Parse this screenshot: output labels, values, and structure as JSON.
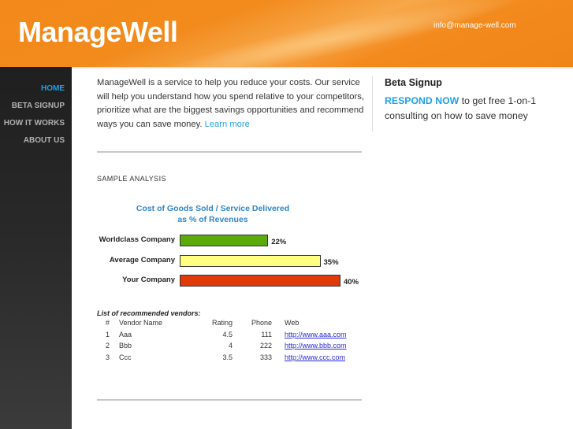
{
  "header": {
    "logo": "ManageWell",
    "email": "info@manage-well.com"
  },
  "sidebar": {
    "items": [
      {
        "label": "HOME",
        "active": true
      },
      {
        "label": "BETA SIGNUP",
        "active": false
      },
      {
        "label": "HOW IT WORKS",
        "active": false
      },
      {
        "label": "ABOUT US",
        "active": false
      }
    ]
  },
  "main": {
    "intro": "ManageWell is a service to help you reduce your costs. Our service will help you understand how you spend relative to your competitors, prioritize what are the biggest savings opportunities and recommend ways you can save money.",
    "learn_more": "Learn more",
    "section_label": "SAMPLE ANALYSIS"
  },
  "beta": {
    "title": "Beta Signup",
    "cta": "RESPOND NOW",
    "text": " to get free 1-on-1 consulting on how to save money"
  },
  "chart_data": {
    "type": "bar",
    "orientation": "horizontal",
    "title": "Cost of Goods Sold / Service Delivered",
    "subtitle": "as % of Revenues",
    "categories": [
      "Worldclass Company",
      "Average Company",
      "Your Company"
    ],
    "values": [
      22,
      35,
      40
    ],
    "value_labels": [
      "22%",
      "35%",
      "40%"
    ],
    "colors": [
      "#5aaa0a",
      "#ffff80",
      "#e03a08"
    ],
    "xlabel": "",
    "ylabel": "",
    "xlim": [
      0,
      40
    ],
    "grid": false
  },
  "vendors": {
    "title": "List of recommended vendors:",
    "columns": [
      "#",
      "Vendor Name",
      "Rating",
      "Phone",
      "Web"
    ],
    "rows": [
      {
        "num": "1",
        "name": "Aaa",
        "rating": "4.5",
        "phone": "111",
        "web": "http://www.aaa.com"
      },
      {
        "num": "2",
        "name": "Bbb",
        "rating": "4",
        "phone": "222",
        "web": "http://www.bbb.com"
      },
      {
        "num": "3",
        "name": "Ccc",
        "rating": "3.5",
        "phone": "333",
        "web": "http://www.ccc.com"
      }
    ]
  }
}
